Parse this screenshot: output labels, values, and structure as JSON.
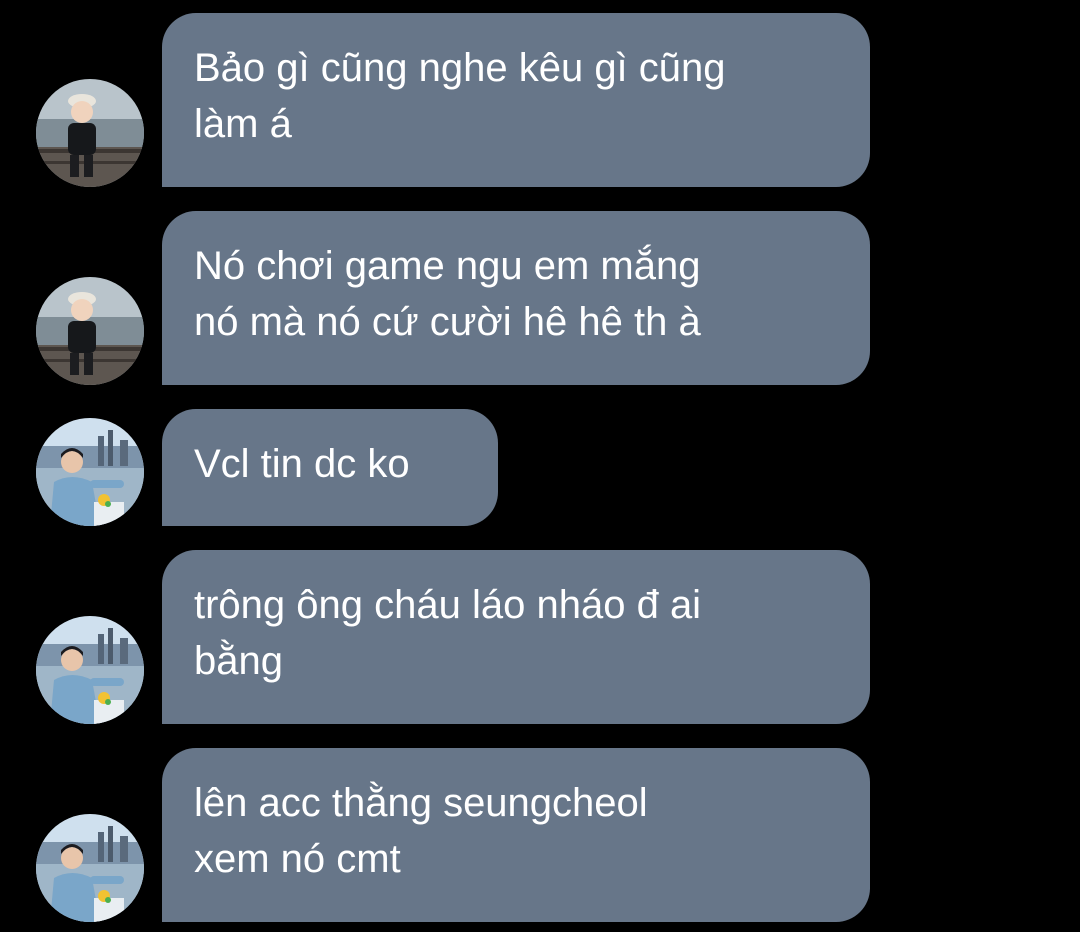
{
  "colors": {
    "background": "#000000",
    "bubble": "#677689",
    "text": "#ffffff"
  },
  "messages": [
    {
      "sender": "avatar-boy",
      "text": "Bảo gì cũng nghe kêu gì cũng\nlàm á"
    },
    {
      "sender": "avatar-boy",
      "text": "Nó chơi game ngu em mắng\nnó mà nó cứ cười hê hê th à"
    },
    {
      "sender": "avatar-man",
      "text": "Vcl tin dc ko"
    },
    {
      "sender": "avatar-man",
      "text": "trông ông cháu láo nháo đ ai\nbằng"
    },
    {
      "sender": "avatar-man",
      "text": "lên acc thằng seungcheol\nxem nó cmt"
    }
  ]
}
